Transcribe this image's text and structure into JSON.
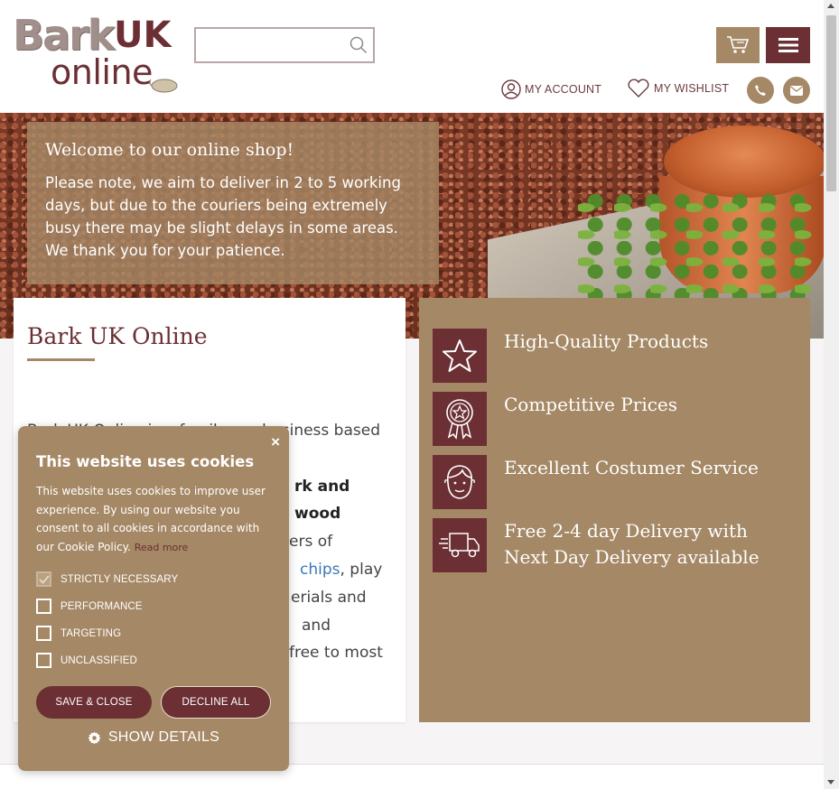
{
  "header": {
    "logo": {
      "word1": "Bark",
      "word2": "UK",
      "word3": "online"
    },
    "search": {
      "placeholder": ""
    },
    "account_label": "MY ACCOUNT",
    "wishlist_label": "MY WISHLIST",
    "icons": [
      "search-icon",
      "cart-icon",
      "hamburger-menu-icon",
      "user-icon",
      "heart-icon",
      "phone-icon",
      "email-icon"
    ]
  },
  "hero": {
    "title": "Welcome to our online shop!",
    "message": "Please note, we aim to deliver in 2 to 5 working days, but due to the couriers being extremely busy there may be slight delays in some areas. We thank you for your patience."
  },
  "intro": {
    "title": "Bark UK Online",
    "line1_prefix": "Bark UK Online is a family run business based in",
    "bold": "rk and wood",
    "line3_suffix": "ers of",
    "link": "chips",
    "after_link": ", play",
    "line5_suffix": "erials and",
    "line6_suffix": "and",
    "line7_suffix": " free to most"
  },
  "features": [
    {
      "icon": "star-icon",
      "text": "High-Quality Products"
    },
    {
      "icon": "award-badge-icon",
      "text": "Competitive Prices"
    },
    {
      "icon": "person-icon",
      "text": "Excellent Costumer Service"
    },
    {
      "icon": "delivery-truck-icon",
      "text": "Free 2-4 day Delivery with Next Day Delivery available"
    }
  ],
  "cookie": {
    "title": "This website uses cookies",
    "description": "This website uses cookies to improve user experience. By using our website you consent to all cookies in accordance with our Cookie Policy.",
    "read_more": "Read more",
    "options": [
      {
        "label": "STRICTLY NECESSARY",
        "checked": true,
        "disabled": true
      },
      {
        "label": "PERFORMANCE",
        "checked": false
      },
      {
        "label": "TARGETING",
        "checked": false
      },
      {
        "label": "UNCLASSIFIED",
        "checked": false
      }
    ],
    "save_label": "SAVE & CLOSE",
    "decline_label": "DECLINE ALL",
    "details_label": "SHOW DETAILS",
    "close_symbol": "×"
  },
  "colors": {
    "brown": "#a58865",
    "maroon": "#6b2f34",
    "link": "#3a78b8"
  }
}
